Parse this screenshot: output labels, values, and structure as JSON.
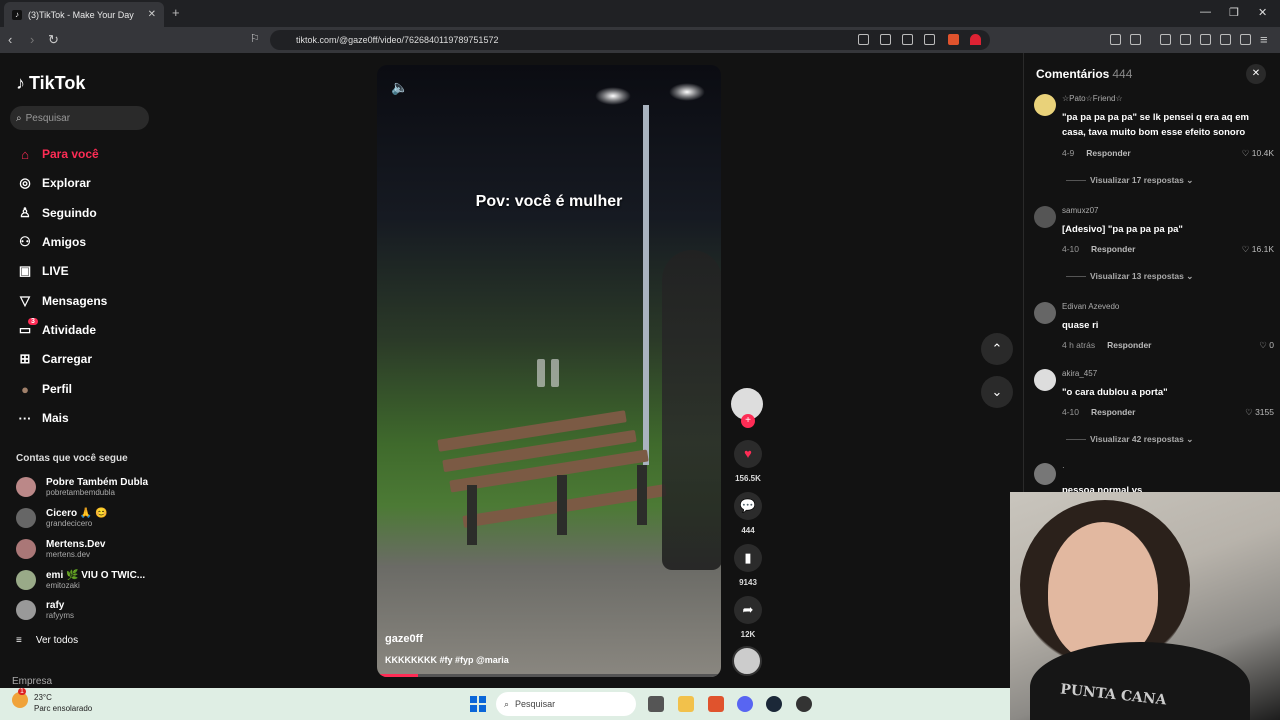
{
  "browser": {
    "tab_title": "(3)TikTok - Make Your Day",
    "tab_close": "✕",
    "new_tab": "+",
    "url": "tiktok.com/@gaze0ff/video/7626840119789751572"
  },
  "sidebar": {
    "logo": "TikTok",
    "search_placeholder": "Pesquisar",
    "nav": [
      {
        "label": "Para você",
        "icon": "home-icon",
        "glyph": "⌂"
      },
      {
        "label": "Explorar",
        "icon": "compass-icon",
        "glyph": "◎"
      },
      {
        "label": "Seguindo",
        "icon": "following-icon",
        "glyph": "♙"
      },
      {
        "label": "Amigos",
        "icon": "friends-icon",
        "glyph": "⚇"
      },
      {
        "label": "LIVE",
        "icon": "live-icon",
        "glyph": "▣"
      },
      {
        "label": "Mensagens",
        "icon": "messages-icon",
        "glyph": "▽"
      },
      {
        "label": "Atividade",
        "icon": "activity-icon",
        "glyph": "▭",
        "badge": "3"
      },
      {
        "label": "Carregar",
        "icon": "upload-icon",
        "glyph": "⊞"
      },
      {
        "label": "Perfil",
        "icon": "profile-icon",
        "glyph": "●"
      },
      {
        "label": "Mais",
        "icon": "more-icon",
        "glyph": "···"
      }
    ],
    "following_title": "Contas que você segue",
    "following": [
      {
        "name": "Pobre Também Dubla",
        "user": "pobretambemdubla"
      },
      {
        "name": "Cicero 🙏 😊",
        "user": "grandecicero"
      },
      {
        "name": "Mertens.Dev",
        "user": "mertens.dev"
      },
      {
        "name": "emi 🌿 VIU O TWIC...",
        "user": "emitozaki"
      },
      {
        "name": "rafy",
        "user": "rafyyms"
      }
    ],
    "see_all": "Ver todos",
    "footer": "Empresa"
  },
  "video": {
    "overlay_text": "Pov: você é mulher",
    "username": "gaze0ff",
    "caption": "KKKKKKKK #fy #fyp @maria",
    "progress": 0.12
  },
  "actions": {
    "likes": "156.5K",
    "comments": "444",
    "saves": "9143",
    "shares": "12K"
  },
  "comments": {
    "title": "Comentários",
    "count": "444",
    "items": [
      {
        "user": "☆Pato☆Friend☆",
        "text": "\"pa pa pa pa pa\" se lk pensei q era aq em casa, tava muito bom esse efeito sonoro",
        "date": "4-9",
        "reply": "Responder",
        "likes": "10.4K",
        "view": "Visualizar 17 respostas ⌄"
      },
      {
        "user": "samuxz07",
        "text": "[Adesivo] \"pa pa pa pa pa\"",
        "date": "4-10",
        "reply": "Responder",
        "likes": "16.1K",
        "view": "Visualizar 13 respostas ⌄"
      },
      {
        "user": "Edivan Azevedo",
        "text": "quase ri",
        "date": "4 h atrás",
        "reply": "Responder",
        "likes": "0",
        "view": ""
      },
      {
        "user": "akira_457",
        "text": "\"o cara dublou a porta\"",
        "date": "4-10",
        "reply": "Responder",
        "likes": "3155",
        "view": "Visualizar 42 respostas ⌄"
      },
      {
        "user": "·",
        "text": "pessoa normal vs",
        "date": "",
        "reply": "",
        "likes": "",
        "view": ""
      }
    ]
  },
  "webcam": {
    "shirt_text": "PUNTA CANA"
  },
  "taskbar": {
    "temp": "23°C",
    "weather": "Parc ensolarado",
    "weather_badge": "1",
    "search": "Pesquisar"
  },
  "colors": {
    "accent": "#fe2c55",
    "bg": "#121212"
  }
}
